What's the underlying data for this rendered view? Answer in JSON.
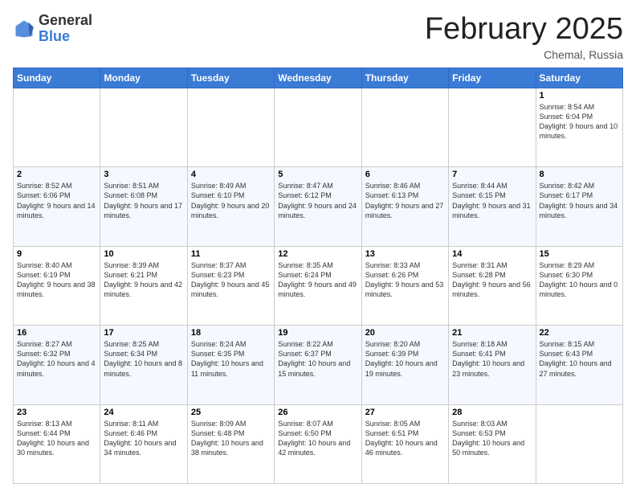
{
  "header": {
    "logo_general": "General",
    "logo_blue": "Blue",
    "month_year": "February 2025",
    "location": "Chemal, Russia"
  },
  "weekdays": [
    "Sunday",
    "Monday",
    "Tuesday",
    "Wednesday",
    "Thursday",
    "Friday",
    "Saturday"
  ],
  "weeks": [
    [
      {
        "day": "",
        "info": ""
      },
      {
        "day": "",
        "info": ""
      },
      {
        "day": "",
        "info": ""
      },
      {
        "day": "",
        "info": ""
      },
      {
        "day": "",
        "info": ""
      },
      {
        "day": "",
        "info": ""
      },
      {
        "day": "1",
        "info": "Sunrise: 8:54 AM\nSunset: 6:04 PM\nDaylight: 9 hours and 10 minutes."
      }
    ],
    [
      {
        "day": "2",
        "info": "Sunrise: 8:52 AM\nSunset: 6:06 PM\nDaylight: 9 hours and 14 minutes."
      },
      {
        "day": "3",
        "info": "Sunrise: 8:51 AM\nSunset: 6:08 PM\nDaylight: 9 hours and 17 minutes."
      },
      {
        "day": "4",
        "info": "Sunrise: 8:49 AM\nSunset: 6:10 PM\nDaylight: 9 hours and 20 minutes."
      },
      {
        "day": "5",
        "info": "Sunrise: 8:47 AM\nSunset: 6:12 PM\nDaylight: 9 hours and 24 minutes."
      },
      {
        "day": "6",
        "info": "Sunrise: 8:46 AM\nSunset: 6:13 PM\nDaylight: 9 hours and 27 minutes."
      },
      {
        "day": "7",
        "info": "Sunrise: 8:44 AM\nSunset: 6:15 PM\nDaylight: 9 hours and 31 minutes."
      },
      {
        "day": "8",
        "info": "Sunrise: 8:42 AM\nSunset: 6:17 PM\nDaylight: 9 hours and 34 minutes."
      }
    ],
    [
      {
        "day": "9",
        "info": "Sunrise: 8:40 AM\nSunset: 6:19 PM\nDaylight: 9 hours and 38 minutes."
      },
      {
        "day": "10",
        "info": "Sunrise: 8:39 AM\nSunset: 6:21 PM\nDaylight: 9 hours and 42 minutes."
      },
      {
        "day": "11",
        "info": "Sunrise: 8:37 AM\nSunset: 6:23 PM\nDaylight: 9 hours and 45 minutes."
      },
      {
        "day": "12",
        "info": "Sunrise: 8:35 AM\nSunset: 6:24 PM\nDaylight: 9 hours and 49 minutes."
      },
      {
        "day": "13",
        "info": "Sunrise: 8:33 AM\nSunset: 6:26 PM\nDaylight: 9 hours and 53 minutes."
      },
      {
        "day": "14",
        "info": "Sunrise: 8:31 AM\nSunset: 6:28 PM\nDaylight: 9 hours and 56 minutes."
      },
      {
        "day": "15",
        "info": "Sunrise: 8:29 AM\nSunset: 6:30 PM\nDaylight: 10 hours and 0 minutes."
      }
    ],
    [
      {
        "day": "16",
        "info": "Sunrise: 8:27 AM\nSunset: 6:32 PM\nDaylight: 10 hours and 4 minutes."
      },
      {
        "day": "17",
        "info": "Sunrise: 8:25 AM\nSunset: 6:34 PM\nDaylight: 10 hours and 8 minutes."
      },
      {
        "day": "18",
        "info": "Sunrise: 8:24 AM\nSunset: 6:35 PM\nDaylight: 10 hours and 11 minutes."
      },
      {
        "day": "19",
        "info": "Sunrise: 8:22 AM\nSunset: 6:37 PM\nDaylight: 10 hours and 15 minutes."
      },
      {
        "day": "20",
        "info": "Sunrise: 8:20 AM\nSunset: 6:39 PM\nDaylight: 10 hours and 19 minutes."
      },
      {
        "day": "21",
        "info": "Sunrise: 8:18 AM\nSunset: 6:41 PM\nDaylight: 10 hours and 23 minutes."
      },
      {
        "day": "22",
        "info": "Sunrise: 8:15 AM\nSunset: 6:43 PM\nDaylight: 10 hours and 27 minutes."
      }
    ],
    [
      {
        "day": "23",
        "info": "Sunrise: 8:13 AM\nSunset: 6:44 PM\nDaylight: 10 hours and 30 minutes."
      },
      {
        "day": "24",
        "info": "Sunrise: 8:11 AM\nSunset: 6:46 PM\nDaylight: 10 hours and 34 minutes."
      },
      {
        "day": "25",
        "info": "Sunrise: 8:09 AM\nSunset: 6:48 PM\nDaylight: 10 hours and 38 minutes."
      },
      {
        "day": "26",
        "info": "Sunrise: 8:07 AM\nSunset: 6:50 PM\nDaylight: 10 hours and 42 minutes."
      },
      {
        "day": "27",
        "info": "Sunrise: 8:05 AM\nSunset: 6:51 PM\nDaylight: 10 hours and 46 minutes."
      },
      {
        "day": "28",
        "info": "Sunrise: 8:03 AM\nSunset: 6:53 PM\nDaylight: 10 hours and 50 minutes."
      },
      {
        "day": "",
        "info": ""
      }
    ]
  ]
}
